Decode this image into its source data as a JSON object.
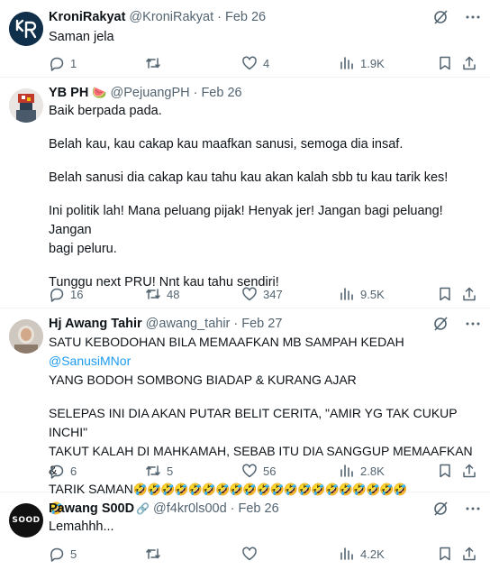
{
  "tweets": [
    {
      "name": "KroniRakyat",
      "handle": "@KroniRakyat",
      "dot": "·",
      "date": "Feb 26",
      "lines": [
        "Saman jela"
      ],
      "replies": "1",
      "retweets": "",
      "likes": "4",
      "views": "1.9K"
    },
    {
      "name": "YB PH",
      "name_emoji": "🍉",
      "handle": "@PejuangPH",
      "dot": "·",
      "date": "Feb 26",
      "lines": [
        "Baik berpada pada.",
        "Belah kau, kau cakap kau maafkan sanusi, semoga dia insaf.",
        "Belah sanusi dia cakap kau tahu kau akan kalah sbb tu kau tarik kes!",
        "Ini politik lah! Mana peluang pijak! Henyak jer! Jangan bagi peluang! Jangan",
        "bagi peluru.",
        "Tunggu next PRU! Nnt kau tahu sendiri!"
      ],
      "replies": "16",
      "retweets": "48",
      "likes": "347",
      "views": "9.5K"
    },
    {
      "name": "Hj Awang Tahir",
      "handle": "@awang_tahir",
      "dot": "·",
      "date": "Feb 27",
      "line1_text": "SATU KEBODOHAN BILA MEMAAFKAN MB SAMPAH KEDAH ",
      "line1_mention": "@SanusiMNor",
      "line2": "YANG BODOH SOMBONG BIADAP & KURANG AJAR",
      "line3": "SELEPAS INI DIA AKAN PUTAR BELIT CERITA, \"AMIR YG TAK CUKUP INCHI\"",
      "line4": "TAKUT KALAH DI MAHKAMAH, SEBAB ITU DIA SANGGUP MEMAAFKAN &",
      "line5": "TARIK SAMAN",
      "emoji_row1": "🤣🤣🤣🤣🤣🤣🤣🤣🤣🤣🤣🤣🤣🤣🤣🤣🤣🤣🤣🤣",
      "emoji_row2": "🤣",
      "replies": "6",
      "retweets": "5",
      "likes": "56",
      "views": "2.8K"
    },
    {
      "name": "Pawang S00D",
      "name_emoji": "🔗",
      "handle": "@f4kr0ls00d",
      "dot": "·",
      "date": "Feb 26",
      "avatar_text": "SOOD",
      "lines": [
        "Lemahhh..."
      ],
      "replies": "5",
      "retweets": "",
      "likes": "",
      "views": "4.2K"
    }
  ],
  "colors": {
    "text": "#0f1419",
    "muted": "#536471",
    "link": "#1d9bf0",
    "divider": "#eff3f4",
    "avatar1": "#0f2f4a"
  },
  "icons": [
    "grok-icon",
    "more-icon",
    "reply-icon",
    "retweet-icon",
    "like-icon",
    "views-icon",
    "bookmark-icon",
    "share-icon"
  ]
}
